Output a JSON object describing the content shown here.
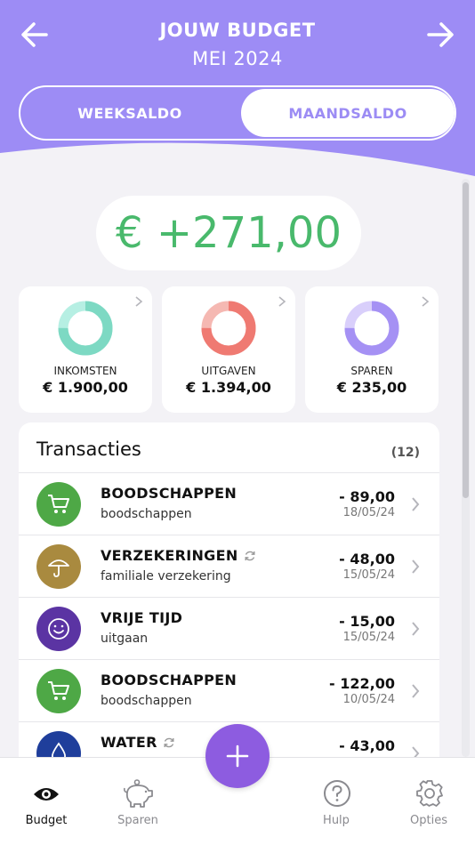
{
  "header": {
    "title": "JOUW BUDGET",
    "period": "MEI 2024",
    "accent_color": "#9d8cf5"
  },
  "toggle": {
    "options": [
      "WEEKSALDO",
      "MAANDSALDO"
    ],
    "selected": "MAANDSALDO"
  },
  "balance": "€ +271,00",
  "summary": [
    {
      "label": "INKOMSTEN",
      "amount": "€ 1.900,00",
      "color": "#7dd9c3",
      "light": "#b6efe3",
      "fill": 0.75
    },
    {
      "label": "UITGAVEN",
      "amount": "€ 1.394,00",
      "color": "#ef7a72",
      "light": "#f5b8b2",
      "fill": 0.75
    },
    {
      "label": "SPAREN",
      "amount": "€ 235,00",
      "color": "#a591f4",
      "light": "#d9cffb",
      "fill": 0.75
    }
  ],
  "transactions": {
    "heading": "Transacties",
    "count": "(12)",
    "items": [
      {
        "category": "BOODSCHAPPEN",
        "description": "boodschappen",
        "amount": "- 89,00",
        "date": "18/05/24",
        "icon": "cart-icon",
        "color": "#4ea846",
        "recurring": false
      },
      {
        "category": "VERZEKERINGEN",
        "description": "familiale verzekering",
        "amount": "- 48,00",
        "date": "15/05/24",
        "icon": "umbrella-icon",
        "color": "#a98a3f",
        "recurring": true
      },
      {
        "category": "VRIJE TIJD",
        "description": "uitgaan",
        "amount": "- 15,00",
        "date": "15/05/24",
        "icon": "smiley-icon",
        "color": "#5b34a3",
        "recurring": false
      },
      {
        "category": "BOODSCHAPPEN",
        "description": "boodschappen",
        "amount": "- 122,00",
        "date": "10/05/24",
        "icon": "cart-icon",
        "color": "#4ea846",
        "recurring": false
      },
      {
        "category": "WATER",
        "description": "",
        "amount": "- 43,00",
        "date": "",
        "icon": "water-drop-icon",
        "color": "#1f3e9b",
        "recurring": true
      }
    ]
  },
  "tabs": [
    {
      "label": "Budget",
      "icon": "eye-icon",
      "active": true
    },
    {
      "label": "Sparen",
      "icon": "piggy-bank-icon",
      "active": false
    },
    {
      "label": "Hulp",
      "icon": "help-icon",
      "active": false
    },
    {
      "label": "Opties",
      "icon": "gear-icon",
      "active": false
    }
  ],
  "fab_icon": "plus-icon"
}
